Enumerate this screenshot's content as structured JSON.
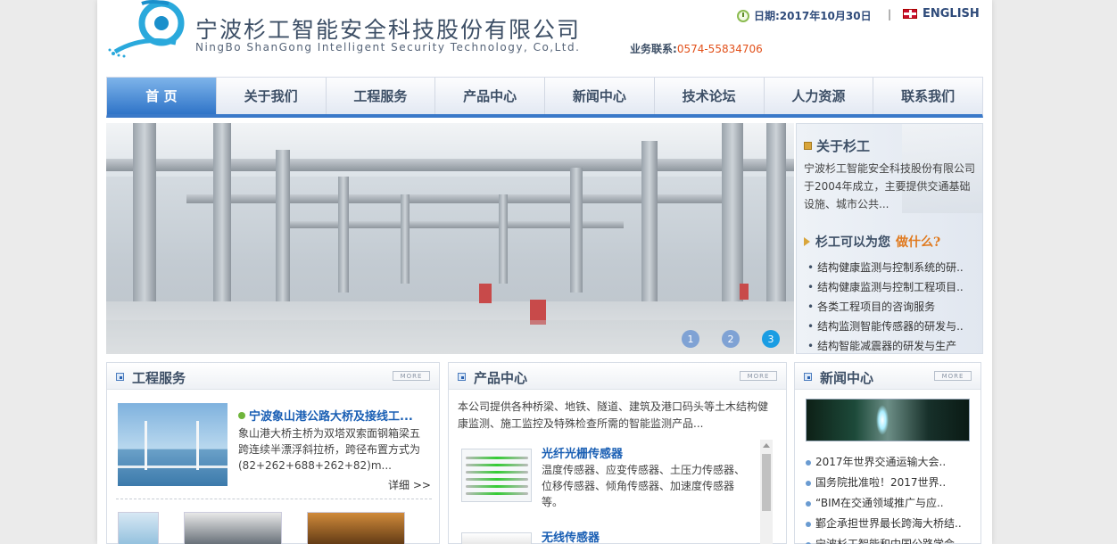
{
  "header": {
    "company_cn": "宁波杉工智能安全科技股份有限公司",
    "company_en": "NingBo ShanGong Intelligent Security Technology, Co,Ltd.",
    "date_label": "日期:2017年10月30日",
    "separator": "|",
    "english_label": "ENGLISH",
    "contact_label": "业务联系:",
    "contact_phone": "0574-55834706"
  },
  "nav": [
    {
      "label": "首 页"
    },
    {
      "label": "关于我们"
    },
    {
      "label": "工程服务"
    },
    {
      "label": "产品中心"
    },
    {
      "label": "新闻中心"
    },
    {
      "label": "技术论坛"
    },
    {
      "label": "人力资源"
    },
    {
      "label": "联系我们"
    }
  ],
  "banner": {
    "dots": [
      "1",
      "2",
      "3"
    ],
    "active": 3
  },
  "about": {
    "title": "关于杉工",
    "text": "宁波杉工智能安全科技股份有限公司于2004年成立，主要提供交通基础设施、城市公共...",
    "what_prefix": "杉工可以为您",
    "what_highlight": "做什么?",
    "items": [
      "结构健康监测与控制系统的研..",
      "结构健康监测与控制工程项目..",
      "各类工程项目的咨询服务",
      "结构监测智能传感器的研发与..",
      "结构智能减震器的研发与生产"
    ]
  },
  "engineering": {
    "title": "工程服务",
    "more": "MORE",
    "item_title": "宁波象山港公路大桥及接线工...",
    "item_text": "象山港大桥主桥为双塔双索面钢箱梁五跨连续半漂浮斜拉桥，跨径布置方式为(82+262+688+262+82)m...",
    "detail": "详细 >>"
  },
  "products": {
    "title": "产品中心",
    "more": "MORE",
    "intro": "本公司提供各种桥梁、地铁、隧道、建筑及港口码头等土木结构健康监测、施工监控及特殊检查所需的智能监测产品...",
    "items": [
      {
        "name": "光纤光栅传感器",
        "desc": "温度传感器、应变传感器、土压力传感器、位移传感器、倾角传感器、加速度传感器等。"
      },
      {
        "name": "无线传感器",
        "desc": ""
      }
    ]
  },
  "news": {
    "title": "新闻中心",
    "more": "MORE",
    "items": [
      "2017年世界交通运输大会..",
      "国务院批准啦！2017世界..",
      "“BIM在交通领域推广与应..",
      "鄞企承担世界最长跨海大桥结..",
      "宁波杉工智能和中国公路学会.."
    ]
  }
}
